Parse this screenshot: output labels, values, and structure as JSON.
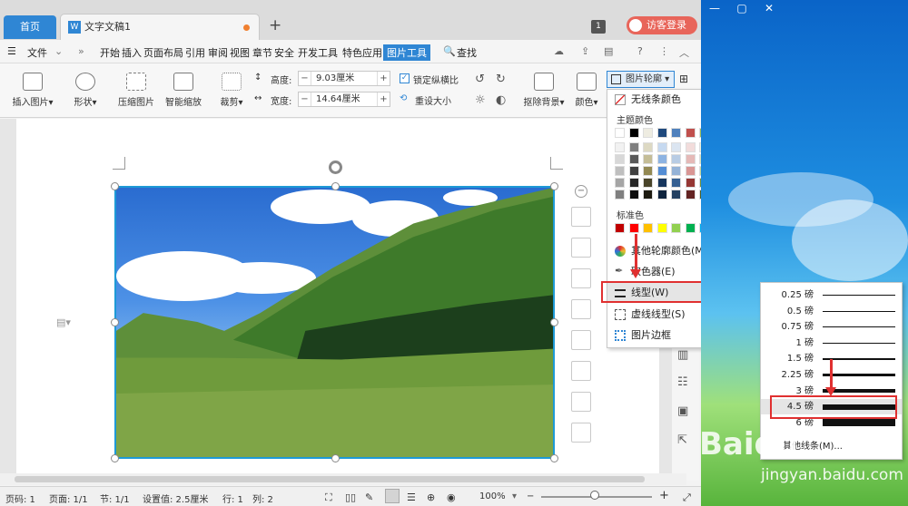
{
  "tabs": {
    "home": "首页",
    "doc": "文字文稿1",
    "new": "+"
  },
  "titlebar": {
    "badge": "1",
    "login": "访客登录"
  },
  "menubar": {
    "file": "文件",
    "items": [
      "开始",
      "插入",
      "页面布局",
      "引用",
      "审阅",
      "视图",
      "章节",
      "安全",
      "开发工具",
      "特色应用",
      "图片工具"
    ],
    "active_index": 10,
    "search": "查找"
  },
  "ribbon": {
    "insert_picture": "插入图片",
    "shape": "形状",
    "compress": "压缩图片",
    "smart_scale": "智能缩放",
    "crop": "裁剪",
    "height_label": "高度:",
    "height_value": "9.03厘米",
    "width_label": "宽度:",
    "width_value": "14.64厘米",
    "lock_ratio": "锁定纵横比",
    "reset_size": "重设大小",
    "remove_bg": "抠除背景",
    "color": "颜色",
    "outline": "图片轮廓"
  },
  "dropdown": {
    "no_line": "无线条颜色",
    "theme_colors": "主题颜色",
    "standard_colors": "标准色",
    "more_colors": "其他轮廓颜色(M)...",
    "eyedropper": "取色器(E)",
    "line_type": "线型(W)",
    "dash_type": "虚线线型(S)",
    "picture_border": "图片边框"
  },
  "theme_rows": [
    [
      "#ffffff",
      "#000000",
      "#eeece1",
      "#1f497d",
      "#4f81bd",
      "#c0504d",
      "#9bbb59",
      "#8064a2",
      "#4bacc6",
      "#f79646"
    ],
    [
      "#f2f2f2",
      "#7f7f7f",
      "#ddd9c3",
      "#c6d9f0",
      "#dbe5f1",
      "#f2dcdb",
      "#ebf1dd",
      "#e5e0ec",
      "#dbeef3",
      "#fdeada"
    ],
    [
      "#d8d8d8",
      "#595959",
      "#c4bd97",
      "#8db3e2",
      "#b8cce4",
      "#e5b9b7",
      "#d7e3bc",
      "#ccc1d9",
      "#b7dde8",
      "#fbd5b5"
    ],
    [
      "#bfbfbf",
      "#3f3f3f",
      "#938953",
      "#548dd4",
      "#95b3d7",
      "#d99694",
      "#c3d69b",
      "#b2a2c7",
      "#92cddc",
      "#fac08f"
    ],
    [
      "#a5a5a5",
      "#262626",
      "#494429",
      "#17365d",
      "#366092",
      "#953734",
      "#76923c",
      "#5f497a",
      "#31859b",
      "#e36c09"
    ],
    [
      "#7f7f7f",
      "#0c0c0c",
      "#1d1b10",
      "#0f243e",
      "#244061",
      "#632423",
      "#4f6128",
      "#3f3151",
      "#205867",
      "#974806"
    ]
  ],
  "standard_row": [
    "#c00000",
    "#ff0000",
    "#ffc000",
    "#ffff00",
    "#92d050",
    "#00b050",
    "#00b0f0",
    "#0070c0",
    "#002060",
    "#7030a0"
  ],
  "line_weights": [
    {
      "label": "0.25 磅",
      "w": 1
    },
    {
      "label": "0.5 磅",
      "w": 1
    },
    {
      "label": "0.75 磅",
      "w": 1.5
    },
    {
      "label": "1 磅",
      "w": 1.5
    },
    {
      "label": "1.5 磅",
      "w": 2
    },
    {
      "label": "2.25 磅",
      "w": 3
    },
    {
      "label": "3 磅",
      "w": 4
    },
    {
      "label": "4.5 磅",
      "w": 6
    },
    {
      "label": "6 磅",
      "w": 8
    }
  ],
  "line_more": "其他线条(M)...",
  "status": {
    "page_no": "页码: 1",
    "pages": "页面: 1/1",
    "section": "节: 1/1",
    "setting": "设置值: 2.5厘米",
    "row": "行: 1",
    "col": "列: 2",
    "zoom": "100%",
    "zoom_minus": "−",
    "zoom_plus": "+"
  },
  "watermark": {
    "brand": "Baidu",
    "url": "jingyan.baidu.com"
  },
  "colors": {
    "accent": "#2f86d4",
    "highlight": "#e03030",
    "selection": "#1e9ad6"
  }
}
